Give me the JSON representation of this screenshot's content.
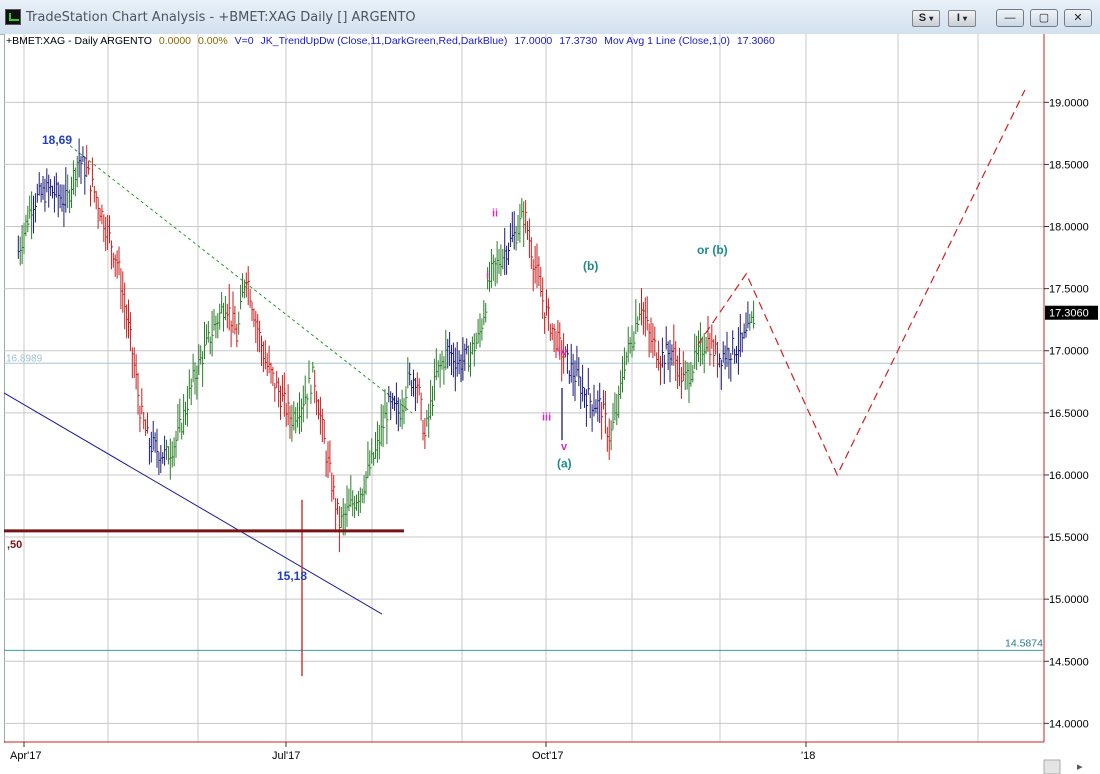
{
  "window": {
    "title": "TradeStation Chart Analysis - +BMET:XAG Daily [] ARGENTO",
    "btn_s": "S",
    "btn_i": "I",
    "min_glyph": "—",
    "max_glyph": "▢",
    "close_glyph": "✕"
  },
  "infobar": {
    "symbol": "+BMET:XAG - Daily  ARGENTO",
    "change": "0.0000",
    "change_pct": "0.00%",
    "volume": "V=0",
    "indicator": "JK_TrendUpDw (Close,11,DarkGreen,Red,DarkBlue)",
    "ind_val1": "17.0000",
    "ind_val2": "17.3730",
    "mov_avg": "Mov Avg 1 Line (Close,1,0)",
    "mov_avg_val": "17.3060"
  },
  "colors": {
    "up": "#2a7d2a",
    "down": "#c81e1e",
    "neutral": "#1c1c7a",
    "grid": "#c8c8c8",
    "axis_red": "#cc2222",
    "support": "#7a1414",
    "trendline": "#1a1aa0",
    "cyan_line": "#3aa0a0",
    "projection": "#d02020",
    "wave_teal": "#1e8a8a",
    "wave_magenta": "#d030c0",
    "blue_label": "#1f3fbf"
  },
  "chart_data": {
    "type": "ohlc",
    "symbol": "+BMET:XAG",
    "ylim": [
      13.85,
      19.55
    ],
    "y_ticks": [
      "19.0000",
      "18.5000",
      "18.0000",
      "17.5000",
      "17.0000",
      "16.5000",
      "16.0000",
      "15.5000",
      "15.0000",
      "14.5000",
      "14.0000"
    ],
    "x_ticks": [
      "Apr'17",
      "Jul'17",
      "Oct'17",
      "'18"
    ],
    "last_price": "17.3060",
    "levels": [
      {
        "value": 16.8989,
        "label": "16.8989"
      },
      {
        "value": 14.5874,
        "label": "14.5874"
      }
    ],
    "key_points": [
      {
        "label": "18,69",
        "value": 18.69
      },
      {
        "label": "15,18",
        "value": 15.18
      }
    ],
    "support_level": {
      "value": 15.55,
      "label": ",50"
    },
    "wave_labels": [
      {
        "text": "ii",
        "color": "magenta"
      },
      {
        "text": "i",
        "color": "magenta"
      },
      {
        "text": "iv",
        "color": "magenta"
      },
      {
        "text": "iii",
        "color": "magenta"
      },
      {
        "text": "v",
        "color": "magenta"
      },
      {
        "text": "(a)",
        "color": "teal"
      },
      {
        "text": "(b)",
        "color": "teal"
      },
      {
        "text": "or (b)",
        "color": "teal"
      }
    ],
    "projection": [
      {
        "date": "2017-11-24",
        "value": 17.05
      },
      {
        "date": "2017-12-11",
        "value": 17.62
      },
      {
        "date": "2018-01-12",
        "value": 16.0
      },
      {
        "date": "2018-03-19",
        "value": 19.1
      }
    ],
    "close_path": [
      {
        "date": "2017-03-30",
        "value": 17.8
      },
      {
        "date": "2017-04-04",
        "value": 18.2
      },
      {
        "date": "2017-04-10",
        "value": 18.3
      },
      {
        "date": "2017-04-16",
        "value": 18.2
      },
      {
        "date": "2017-04-20",
        "value": 18.55
      },
      {
        "date": "2017-04-23",
        "value": 18.45
      },
      {
        "date": "2017-04-27",
        "value": 18.2
      },
      {
        "date": "2017-05-04",
        "value": 17.7
      },
      {
        "date": "2017-05-09",
        "value": 17.0
      },
      {
        "date": "2017-05-12",
        "value": 16.5
      },
      {
        "date": "2017-05-15",
        "value": 16.25
      },
      {
        "date": "2017-05-21",
        "value": 16.15
      },
      {
        "date": "2017-05-25",
        "value": 16.3
      },
      {
        "date": "2017-05-31",
        "value": 16.8
      },
      {
        "date": "2017-06-07",
        "value": 17.2
      },
      {
        "date": "2017-06-11",
        "value": 17.4
      },
      {
        "date": "2017-06-15",
        "value": 17.1
      },
      {
        "date": "2017-06-18",
        "value": 17.65
      },
      {
        "date": "2017-06-21",
        "value": 17.3
      },
      {
        "date": "2017-06-25",
        "value": 16.9
      },
      {
        "date": "2017-06-29",
        "value": 16.7
      },
      {
        "date": "2017-07-04",
        "value": 16.45
      },
      {
        "date": "2017-07-08",
        "value": 16.6
      },
      {
        "date": "2017-07-12",
        "value": 16.8
      },
      {
        "date": "2017-07-16",
        "value": 16.2
      },
      {
        "date": "2017-07-21",
        "value": 15.6
      },
      {
        "date": "2017-07-25",
        "value": 15.75
      },
      {
        "date": "2017-07-29",
        "value": 15.9
      },
      {
        "date": "2017-08-03",
        "value": 16.2
      },
      {
        "date": "2017-08-07",
        "value": 16.55
      },
      {
        "date": "2017-08-11",
        "value": 16.5
      },
      {
        "date": "2017-08-14",
        "value": 16.75
      },
      {
        "date": "2017-08-17",
        "value": 16.8
      },
      {
        "date": "2017-08-20",
        "value": 16.3
      },
      {
        "date": "2017-08-24",
        "value": 16.8
      },
      {
        "date": "2017-08-28",
        "value": 17.0
      },
      {
        "date": "2017-09-01",
        "value": 16.9
      },
      {
        "date": "2017-09-04",
        "value": 16.95
      },
      {
        "date": "2017-09-08",
        "value": 17.1
      },
      {
        "date": "2017-09-12",
        "value": 17.6
      },
      {
        "date": "2017-09-17",
        "value": 17.8
      },
      {
        "date": "2017-09-21",
        "value": 17.95
      },
      {
        "date": "2017-09-24",
        "value": 18.1
      },
      {
        "date": "2017-09-27",
        "value": 17.75
      },
      {
        "date": "2017-10-01",
        "value": 17.35
      },
      {
        "date": "2017-10-05",
        "value": 17.1
      },
      {
        "date": "2017-10-09",
        "value": 16.9
      },
      {
        "date": "2017-10-13",
        "value": 16.75
      },
      {
        "date": "2017-10-17",
        "value": 16.6
      },
      {
        "date": "2017-10-21",
        "value": 16.55
      },
      {
        "date": "2017-10-24",
        "value": 16.3
      },
      {
        "date": "2017-10-27",
        "value": 16.55
      },
      {
        "date": "2017-10-29",
        "value": 16.9
      },
      {
        "date": "2017-11-01",
        "value": 17.1
      },
      {
        "date": "2017-11-04",
        "value": 17.4
      },
      {
        "date": "2017-11-07",
        "value": 17.1
      },
      {
        "date": "2017-11-11",
        "value": 16.95
      },
      {
        "date": "2017-11-15",
        "value": 17.0
      },
      {
        "date": "2017-11-19",
        "value": 16.75
      },
      {
        "date": "2017-11-24",
        "value": 16.95
      },
      {
        "date": "2017-11-27",
        "value": 17.1
      },
      {
        "date": "2017-12-01",
        "value": 16.95
      },
      {
        "date": "2017-12-05",
        "value": 17.0
      },
      {
        "date": "2017-12-09",
        "value": 17.05
      },
      {
        "date": "2017-12-12",
        "value": 17.15
      },
      {
        "date": "2017-12-14",
        "value": 17.3
      }
    ]
  }
}
